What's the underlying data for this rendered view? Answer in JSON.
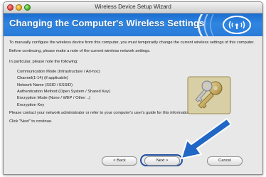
{
  "window": {
    "title": "Wireless Device Setup Wizard"
  },
  "header": {
    "title": "Changing the Computer's Wireless Settings"
  },
  "content": {
    "intro": "To manually configure the wireless device from this computer, you must temporarily change the current wireless settings of this computer.",
    "note": "Before continuing, please make a note of the current wireless network settings.",
    "particular": "In particular, please note the following:",
    "settings": [
      "Communication Mode (Infrastructure / Ad-hoc)",
      "Channel(1-14) (if applicable)",
      "Network Name (SSID / ESSID)",
      "Authentication Method (Open System / Shared Key)",
      "Encryption Mode (None / WEP / Other ..)",
      "Encryption Key"
    ],
    "contact": "Please contact your network administrator or refer to your computer's user's guide for this information.",
    "continue": "Click \"Next\" to continue."
  },
  "buttons": {
    "back": "< Back",
    "next": "Next >",
    "cancel": "Cancel"
  },
  "colors": {
    "header": "#2a7ad8",
    "accent_arrow": "#2168c6"
  }
}
